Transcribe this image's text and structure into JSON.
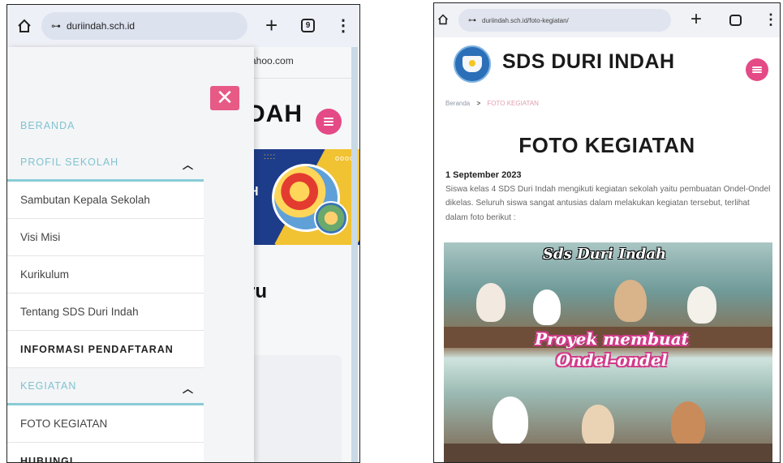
{
  "left": {
    "browser": {
      "url": "duriindah.sch.id",
      "tab_count": "9",
      "new_tab": "+",
      "menu": "⋮"
    },
    "behind": {
      "email_fragment": "yahoo.com",
      "title_fragment": "DAH",
      "heading_fragment": "ru",
      "banner_dots": "oooo",
      "banner_dots2": "::::",
      "banner_frag": "H"
    },
    "drawer": {
      "close": "✕",
      "items": [
        {
          "label": "BERANDA"
        },
        {
          "label": "PROFIL SEKOLAH",
          "chevron": "^"
        },
        {
          "label": "Sambutan Kepala Sekolah"
        },
        {
          "label": "Visi Misi"
        },
        {
          "label": "Kurikulum"
        },
        {
          "label": "Tentang SDS Duri Indah"
        },
        {
          "label": "INFORMASI PENDAFTARAN"
        },
        {
          "label": "KEGIATAN",
          "chevron": "^"
        },
        {
          "label": "FOTO KEGIATAN"
        },
        {
          "label": "HUBUNGI"
        }
      ]
    }
  },
  "right": {
    "browser": {
      "url": "duriindah.sch.id/foto-kegiatan/",
      "new_tab": "+",
      "tab_count": "",
      "menu": "⋮"
    },
    "site_title": "SDS DURI INDAH",
    "breadcrumb": {
      "home": "Beranda",
      "sep": ">",
      "current": "FOTO KEGIATAN"
    },
    "page_title": "FOTO KEGIATAN",
    "post_date": "1 September 2023",
    "post_text": "Siswa kelas 4 SDS Duri Indah mengikuti kegiatan sekolah yaitu pembuatan Ondel-Ondel dikelas. Seluruh siswa sangat antusias dalam melakukan kegiatan tersebut, terlihat dalam foto berikut :",
    "photo": {
      "caption_top": "Sds Duri Indah",
      "caption_mid": "Proyek membuat Ondel-ondel"
    }
  },
  "colors": {
    "accent_pink": "#e44a86",
    "menu_teal": "#7fc3d0",
    "banner_blue": "#1d3c8a"
  }
}
